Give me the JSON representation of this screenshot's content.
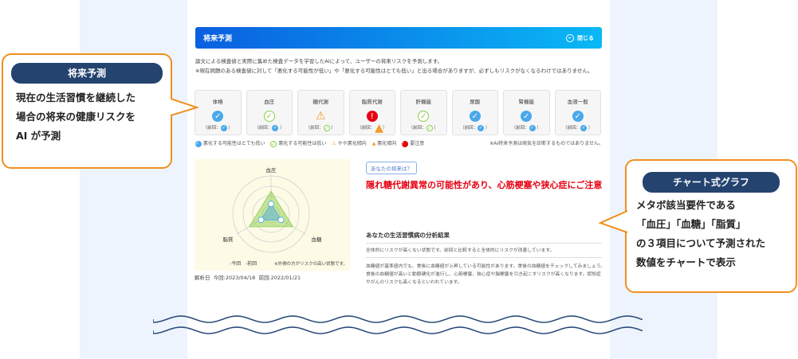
{
  "header": {
    "title": "将来予測",
    "close_label": "閉じる"
  },
  "intro": [
    "論文による検査値と実際に集めた検査データを学習したAIによって、ユーザーの将来リスクを予測します。",
    "※現在問題のある検査値に対して「悪化する可能性が低い」や「悪化する可能性はとても低い」と出る場合がありますが、必ずしもリスクがなくなるわけではありません。"
  ],
  "cards": [
    {
      "label": "体格",
      "status": "very-low",
      "prev_label": "（前回：",
      "prev": "very-low"
    },
    {
      "label": "血圧",
      "status": "low",
      "prev_label": "（前回：",
      "prev": "very-low"
    },
    {
      "label": "糖代謝",
      "status": "slight",
      "prev_label": "（前回：",
      "prev": "low"
    },
    {
      "label": "脂質代謝",
      "status": "caution",
      "prev_label": "（前回：",
      "prev": "worsening"
    },
    {
      "label": "肝機能",
      "status": "low",
      "prev_label": "（前回：",
      "prev": "low"
    },
    {
      "label": "尿酸",
      "status": "very-low",
      "prev_label": "（前回：",
      "prev": "very-low"
    },
    {
      "label": "腎機能",
      "status": "very-low",
      "prev_label": "（前回：",
      "prev": "very-low"
    },
    {
      "label": "血液一般",
      "status": "very-low",
      "prev_label": "（前回：",
      "prev": "very-low"
    }
  ],
  "legend": {
    "very_low": "悪化する可能性はとても低い",
    "low": "悪化する可能性は低い",
    "slight": "やや悪化傾向",
    "worsening": "悪化傾向",
    "caution": "要注意",
    "note": "※AI将来予測は病気を診断するものではありません。"
  },
  "colors": {
    "very_low": "#4aa8ea",
    "low": "#8ccd4c",
    "slight": "#f39a2b",
    "caution": "#e60012",
    "accent": "#0a5fe0"
  },
  "chart_data": {
    "type": "radar",
    "axes": [
      "血圧",
      "血糖",
      "脂質"
    ],
    "series": [
      {
        "name": "今回",
        "values": [
          0.27,
          0.3,
          0.3
        ]
      },
      {
        "name": "前回",
        "values": [
          0.6,
          0.66,
          0.66
        ]
      }
    ],
    "legend": [
      "今回",
      "前回"
    ],
    "note": "※外側の方がリスクの高い状態です。",
    "rmax": 1
  },
  "dates": {
    "label": "解析日",
    "current": "今回:2023/04/18",
    "previous": "前回:2022/01/21"
  },
  "result": {
    "bubble": "あなたの将来は？",
    "headline": "隠れ糖代謝異常の可能性があり、心筋梗塞や狭心症にご注意",
    "section_title": "あなたの生活習慣病の分析結果",
    "summary": "全体的にリスクが高くない状態です。前回と比較すると全体的にリスクが改善しています。",
    "detail1": "血糖値が基準値内でも、食後に血糖値が上昇している可能性があります。食後の血糖値をチェックしてみましょう。",
    "detail2": "食後の血糖値が高いと動脈硬化が進行し、心筋梗塞、狭心症や脳梗塞を引き起こすリスクが高くなります。認知症やがんのリスクも高くなるといわれています。"
  },
  "callout_left": {
    "title": "将来予測",
    "lines": [
      "現在の生活習慣を継続した",
      "場合の将来の健康リスクを",
      "AI が予測"
    ]
  },
  "callout_right": {
    "title": "チャート式グラフ",
    "lines": [
      "メタボ該当要件である",
      "「血圧」「血糖」「脂質」",
      "の３項目について予測された",
      "数値をチャートで表示"
    ]
  }
}
